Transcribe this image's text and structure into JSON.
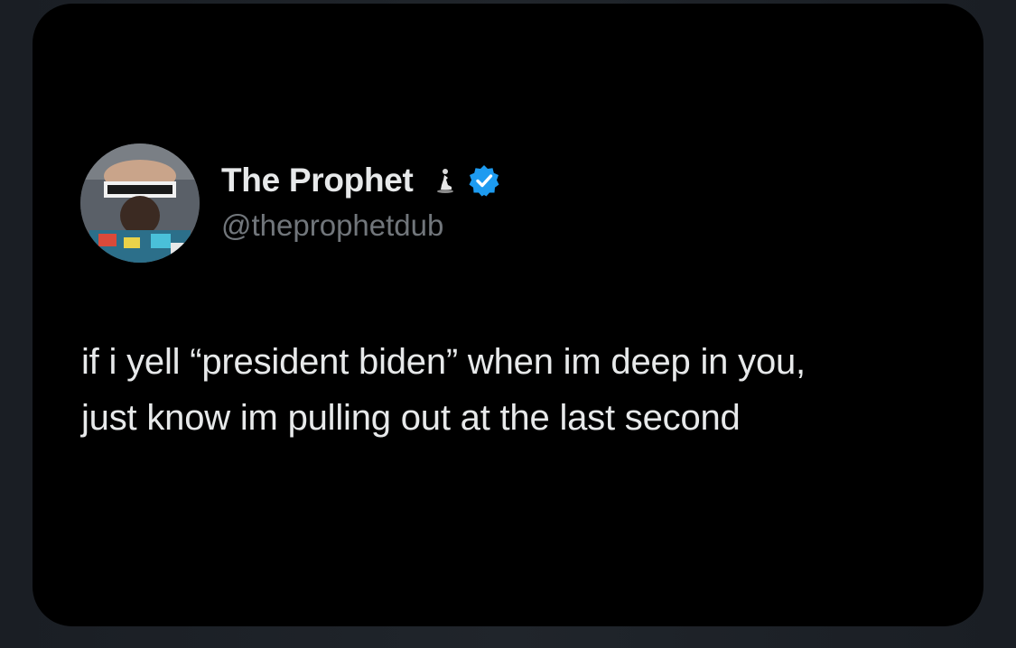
{
  "tweet": {
    "author": {
      "display_name": "The Prophet",
      "handle": "@theprophetdub",
      "name_emoji_icon": "praying-figure-icon",
      "verified_icon": "verified-badge-icon",
      "verified_color": "#1d9bf0"
    },
    "text": "if i yell “president biden” when im deep in you,\njust know im pulling out at the last second"
  },
  "colors": {
    "card_background": "#000000",
    "page_background": "#1b1f25",
    "primary_text": "#e7e9ea",
    "secondary_text": "#71767b"
  }
}
